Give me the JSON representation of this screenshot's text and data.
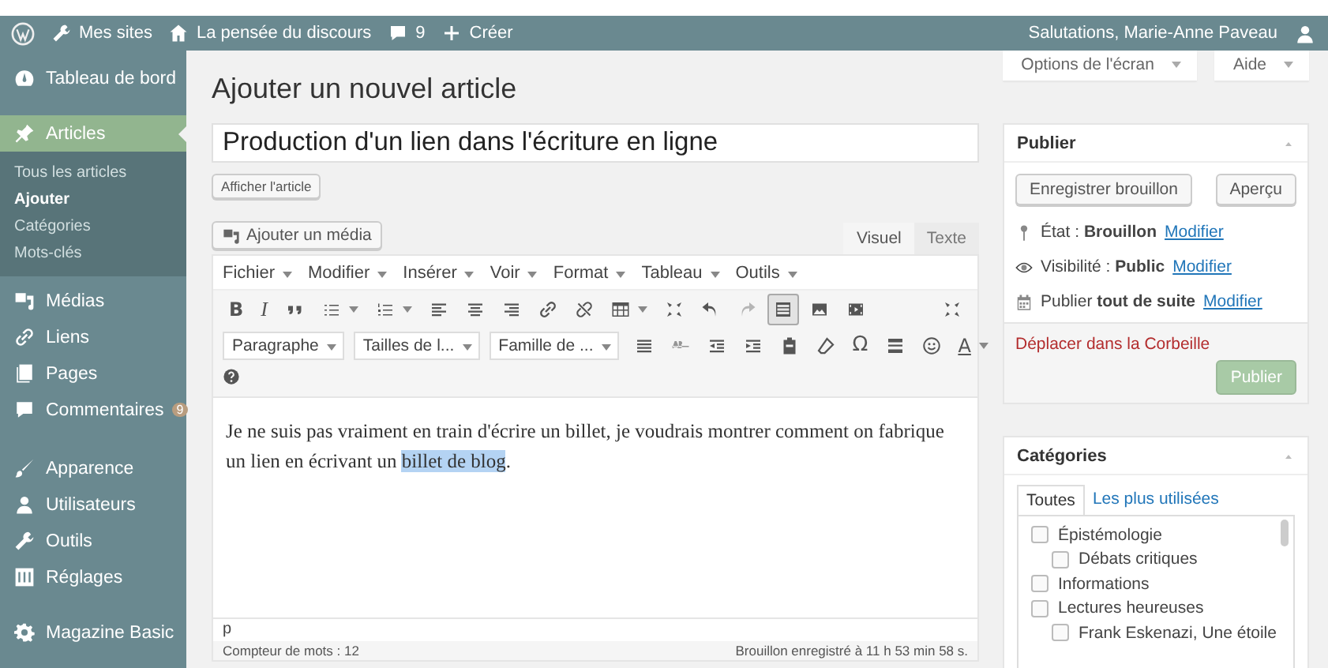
{
  "admin_bar": {
    "my_sites": "Mes sites",
    "site_name": "La pensée du discours",
    "comments_count": "9",
    "new": "Créer",
    "greeting": "Salutations, Marie-Anne Paveau"
  },
  "sidebar": {
    "groups": [
      [
        {
          "label": "Tableau de bord",
          "selected": false
        }
      ],
      [
        {
          "label": "Articles",
          "selected": true,
          "children": [
            {
              "label": "Tous les articles",
              "selected": false
            },
            {
              "label": "Ajouter",
              "selected": true
            },
            {
              "label": "Catégories",
              "selected": false
            },
            {
              "label": "Mots-clés",
              "selected": false
            }
          ]
        },
        {
          "label": "Médias",
          "selected": false
        },
        {
          "label": "Liens",
          "selected": false
        },
        {
          "label": "Pages",
          "selected": false
        },
        {
          "label": "Commentaires",
          "selected": false,
          "badge": "9"
        }
      ],
      [
        {
          "label": "Apparence",
          "selected": false
        },
        {
          "label": "Utilisateurs",
          "selected": false
        },
        {
          "label": "Outils",
          "selected": false
        },
        {
          "label": "Réglages",
          "selected": false
        }
      ],
      [
        {
          "label": "Magazine Basic",
          "selected": false
        }
      ]
    ]
  },
  "screen_tabs": [
    "Options de l'écran",
    "Aide"
  ],
  "page_title": "Ajouter un nouvel article",
  "post_title": "Production d'un lien dans l'écriture en ligne",
  "view_post": "Afficher l'article",
  "add_media": "Ajouter un média",
  "editor_tabs": [
    {
      "label": "Visuel",
      "selected": true
    },
    {
      "label": "Texte",
      "selected": false
    }
  ],
  "menu_bar": [
    "Fichier",
    "Modifier",
    "Insérer",
    "Voir",
    "Format",
    "Tableau",
    "Outils"
  ],
  "toolbar": {
    "bold": "B",
    "italic": "I",
    "toggle_pressed": true,
    "formats": [
      "Paragraphe",
      "Tailles de l...",
      "Famille de ..."
    ],
    "special_char": "Ω",
    "text_color": "A"
  },
  "content": {
    "before": "Je ne suis pas vraiment en train d'écrire un billet, je voudrais montrer comment on fabrique un lien en écrivant un ",
    "selected": "billet de blog",
    "after": "."
  },
  "path": "p",
  "word_count": "Compteur de mots : 12",
  "autosave": "Brouillon enregistré à 11 h 53 min 58 s.",
  "publish": {
    "title": "Publier",
    "save_draft": "Enregistrer brouillon",
    "preview": "Aperçu",
    "rows": [
      {
        "text": "État : **Brouillon**",
        "link": "Modifier"
      },
      {
        "text": "Visibilité : **Public**",
        "link": "Modifier"
      },
      {
        "text": "Publier **tout de suite**",
        "link": "Modifier"
      }
    ],
    "trash": "Déplacer dans la Corbeille",
    "button": "Publier",
    "disabled": true
  },
  "categories": {
    "title": "Catégories",
    "tabs": [
      {
        "label": "Toutes",
        "selected": true
      },
      {
        "label": "Les plus utilisées",
        "selected": false
      }
    ],
    "items": [
      {
        "label": "Épistémologie",
        "checked": false,
        "children": [
          {
            "label": "Débats critiques",
            "checked": false
          }
        ]
      },
      {
        "label": "Informations",
        "checked": false
      },
      {
        "label": "Lectures heureuses",
        "checked": false,
        "children": [
          {
            "label": "Frank Eskenazi, Une étoile",
            "checked": false
          }
        ]
      }
    ]
  }
}
